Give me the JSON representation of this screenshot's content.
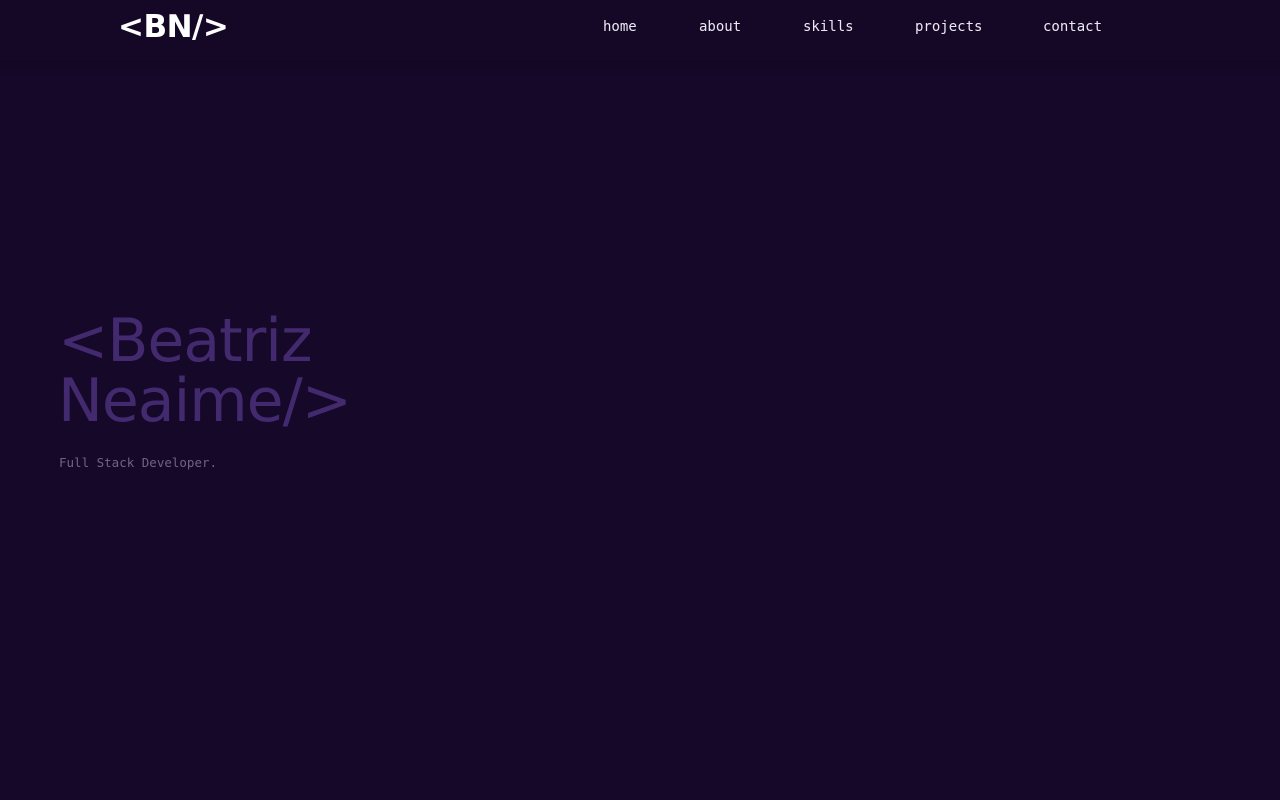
{
  "header": {
    "logo": "<BN/>",
    "nav": [
      {
        "label": "home"
      },
      {
        "label": "about"
      },
      {
        "label": "skills"
      },
      {
        "label": "projects"
      },
      {
        "label": "contact"
      }
    ]
  },
  "hero": {
    "title_line1": "<Beatriz",
    "title_line2": "Neaime/>",
    "subtitle": "Full Stack Developer."
  },
  "colors": {
    "background": "#150828",
    "header_background": "#140826",
    "nav_text": "#ece8f3",
    "logo": "#ffffff",
    "hero_title": "#432a6f",
    "hero_subtitle": "#6e6585"
  }
}
